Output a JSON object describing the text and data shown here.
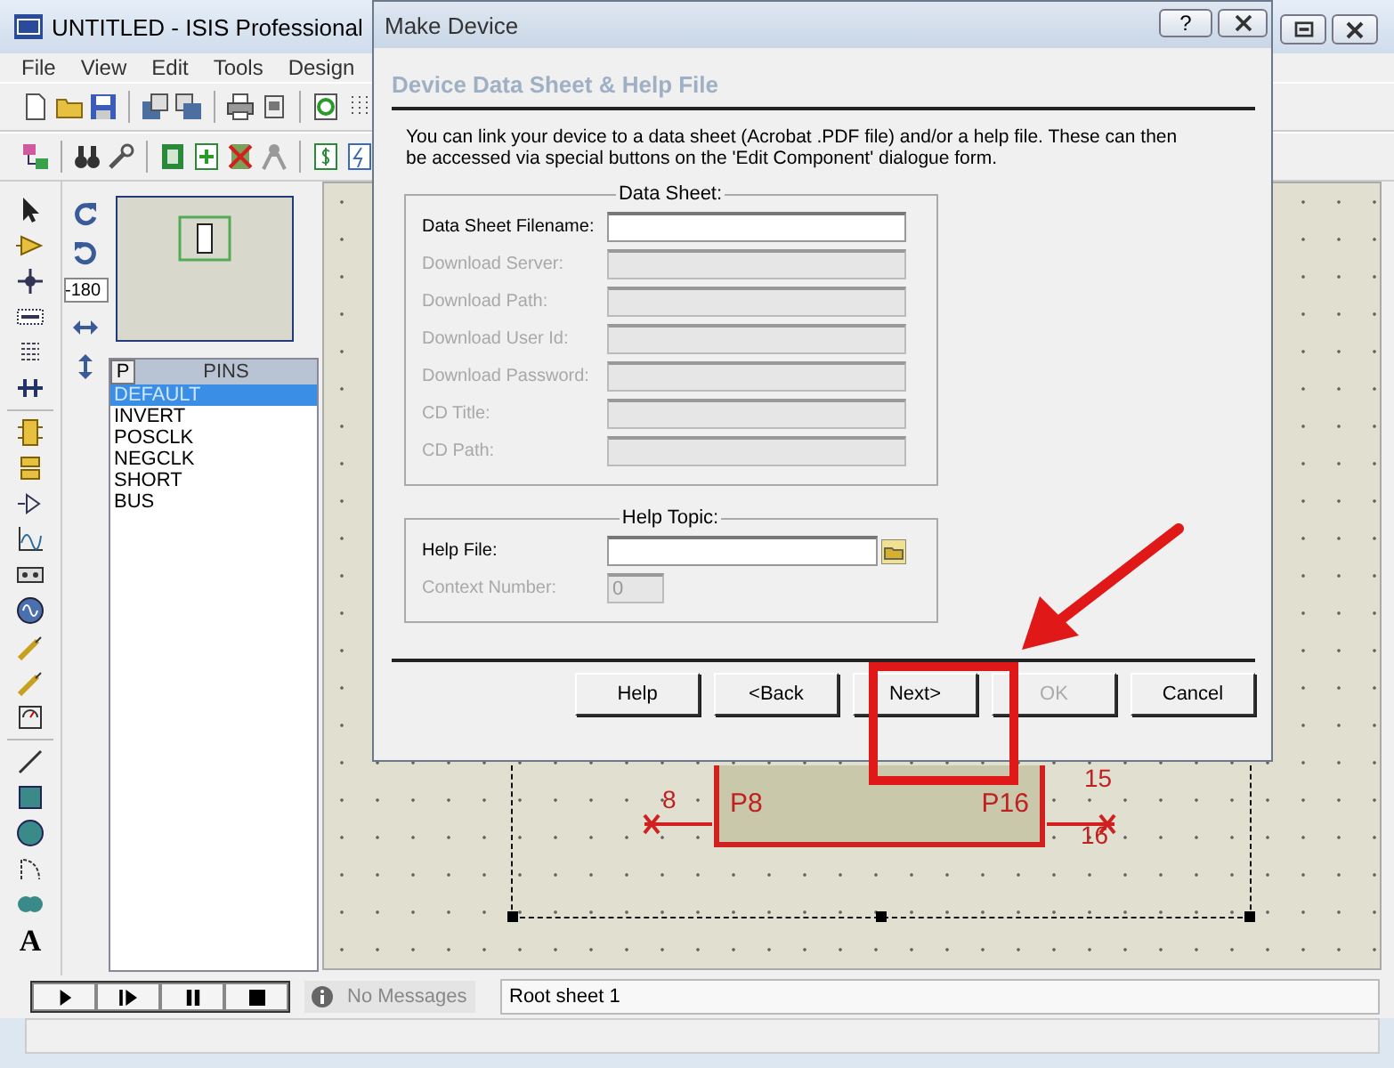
{
  "window": {
    "title": "UNTITLED - ISIS Professional"
  },
  "menu": [
    "File",
    "View",
    "Edit",
    "Tools",
    "Design"
  ],
  "rotation": {
    "value": "-180"
  },
  "text_tool": "A",
  "pins_panel": {
    "button": "P",
    "header": "PINS",
    "items": [
      {
        "label": "DEFAULT",
        "selected": true
      },
      {
        "label": "INVERT",
        "selected": false
      },
      {
        "label": "POSCLK",
        "selected": false
      },
      {
        "label": "NEGCLK",
        "selected": false
      },
      {
        "label": "SHORT",
        "selected": false
      },
      {
        "label": "BUS",
        "selected": false
      }
    ]
  },
  "canvas": {
    "component": {
      "left_pin_label": "P8",
      "right_pin_label": "P16",
      "left_pin_number": "8",
      "right_pin_number": "16",
      "top_pin_number": "15"
    }
  },
  "dialog": {
    "title": "Make Device",
    "help_button": "?",
    "heading": "Device Data Sheet & Help File",
    "description": "You can link your device to a data sheet (Acrobat .PDF file) and/or a help file. These can then be accessed via special buttons on the 'Edit Component' dialogue form.",
    "data_sheet": {
      "title": "Data Sheet:",
      "fields": [
        {
          "label": "Data Sheet Filename:",
          "disabled": false
        },
        {
          "label": "Download Server:",
          "disabled": true
        },
        {
          "label": "Download Path:",
          "disabled": true
        },
        {
          "label": "Download User Id:",
          "disabled": true
        },
        {
          "label": "Download Password:",
          "disabled": true
        },
        {
          "label": "CD Title:",
          "disabled": true
        },
        {
          "label": "CD Path:",
          "disabled": true
        }
      ]
    },
    "help_topic": {
      "title": "Help Topic:",
      "fields": [
        {
          "label": "Help File:",
          "disabled": false,
          "kind": "browse"
        },
        {
          "label": "Context Number:",
          "disabled": true,
          "kind": "short",
          "value": "0"
        }
      ]
    },
    "buttons": [
      {
        "label": "Help",
        "disabled": false
      },
      {
        "label": "<Back",
        "disabled": false
      },
      {
        "label": "Next>",
        "disabled": false
      },
      {
        "label": "OK",
        "disabled": true
      },
      {
        "label": "Cancel",
        "disabled": false
      }
    ]
  },
  "status_bar": {
    "message": "No Messages",
    "sheet": "Root sheet 1"
  }
}
